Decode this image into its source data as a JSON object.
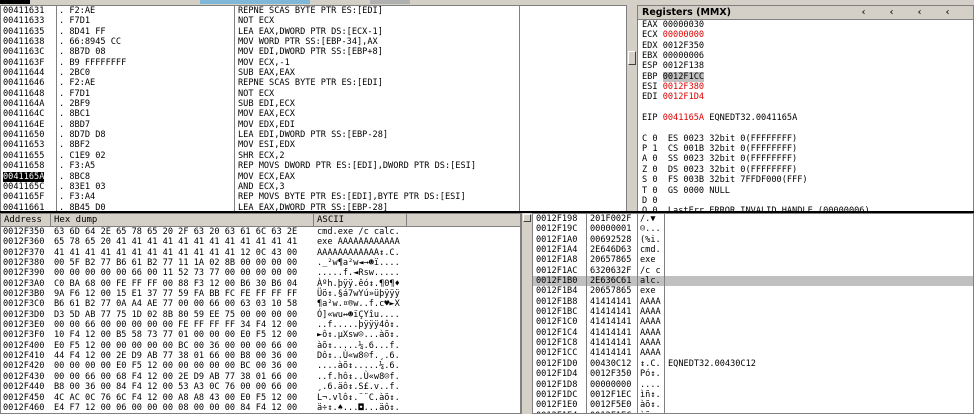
{
  "disasm": {
    "rows": [
      {
        "addr": "00411631",
        "hex": ". F2:AE",
        "asm": "REPNE SCAS BYTE PTR ES:[EDI]",
        "sel": false
      },
      {
        "addr": "00411633",
        "hex": ". F7D1",
        "asm": "NOT ECX",
        "sel": false
      },
      {
        "addr": "00411635",
        "hex": ". 8D41 FF",
        "asm": "LEA EAX,DWORD PTR DS:[ECX-1]",
        "sel": false
      },
      {
        "addr": "00411638",
        "hex": ". 66:8945 CC",
        "asm": "MOV WORD PTR SS:[EBP-34],AX",
        "sel": false
      },
      {
        "addr": "0041163C",
        "hex": ". 8B7D 08",
        "asm": "MOV EDI,DWORD PTR SS:[EBP+8]",
        "sel": false
      },
      {
        "addr": "0041163F",
        "hex": ". B9 FFFFFFFF",
        "asm": "MOV ECX,-1",
        "sel": false
      },
      {
        "addr": "00411644",
        "hex": ". 2BC0",
        "asm": "SUB EAX,EAX",
        "sel": false
      },
      {
        "addr": "00411646",
        "hex": ". F2:AE",
        "asm": "REPNE SCAS BYTE PTR ES:[EDI]",
        "sel": false
      },
      {
        "addr": "00411648",
        "hex": ". F7D1",
        "asm": "NOT ECX",
        "sel": false
      },
      {
        "addr": "0041164A",
        "hex": ". 2BF9",
        "asm": "SUB EDI,ECX",
        "sel": false
      },
      {
        "addr": "0041164C",
        "hex": ". 8BC1",
        "asm": "MOV EAX,ECX",
        "sel": false
      },
      {
        "addr": "0041164E",
        "hex": ". 8BD7",
        "asm": "MOV EDX,EDI",
        "sel": false
      },
      {
        "addr": "00411650",
        "hex": ". 8D7D D8",
        "asm": "LEA EDI,DWORD PTR SS:[EBP-28]",
        "sel": false
      },
      {
        "addr": "00411653",
        "hex": ". 8BF2",
        "asm": "MOV ESI,EDX",
        "sel": false
      },
      {
        "addr": "00411655",
        "hex": ". C1E9 02",
        "asm": "SHR ECX,2",
        "sel": false
      },
      {
        "addr": "00411658",
        "hex": ". F3:A5",
        "asm": "REP MOVS DWORD PTR ES:[EDI],DWORD PTR DS:[ESI]",
        "sel": false
      },
      {
        "addr": "0041165A",
        "hex": ". 8BC8",
        "asm": "MOV ECX,EAX",
        "sel": true
      },
      {
        "addr": "0041165C",
        "hex": ". 83E1 03",
        "asm": "AND ECX,3",
        "sel": false
      },
      {
        "addr": "0041165F",
        "hex": ". F3:A4",
        "asm": "REP MOVS BYTE PTR ES:[EDI],BYTE PTR DS:[ESI]",
        "sel": false
      },
      {
        "addr": "00411661",
        "hex": ". 8B45 D0",
        "asm": "LEA EAX,DWORD PTR SS:[EBP-28]",
        "sel": false
      }
    ]
  },
  "registers": {
    "title": "Registers (MMX)",
    "lines": [
      {
        "text": "EAX 00000030",
        "red": false,
        "grey": false
      },
      {
        "text": "ECX 00000000",
        "red": true,
        "grey": false
      },
      {
        "text": "EDX 0012F350",
        "red": false,
        "grey": false
      },
      {
        "text": "EBX 00000006",
        "red": false,
        "grey": false
      },
      {
        "text": "ESP 0012F138",
        "red": false,
        "grey": false
      },
      {
        "text": "EBP 0012F1CC",
        "red": false,
        "grey": true
      },
      {
        "text": "ESI 0012F380",
        "red": true,
        "grey": false
      },
      {
        "text": "EDI 0012F1D4",
        "red": true,
        "grey": false
      },
      {
        "text": "",
        "red": false,
        "grey": false
      },
      {
        "text": "EIP 0041165A EQNEDT32.0041165A",
        "red": false,
        "grey": false,
        "eip": true
      },
      {
        "text": "",
        "red": false,
        "grey": false
      },
      {
        "text": "C 0  ES 0023 32bit 0(FFFFFFFF)",
        "red": false,
        "grey": false
      },
      {
        "text": "P 1  CS 001B 32bit 0(FFFFFFFF)",
        "red": false,
        "grey": false
      },
      {
        "text": "A 0  SS 0023 32bit 0(FFFFFFFF)",
        "red": false,
        "grey": false
      },
      {
        "text": "Z 0  DS 0023 32bit 0(FFFFFFFF)",
        "red": false,
        "grey": false
      },
      {
        "text": "S 0  FS 003B 32bit 7FFDF000(FFF)",
        "red": false,
        "grey": false
      },
      {
        "text": "T 0  GS 0000 NULL",
        "red": false,
        "grey": false
      },
      {
        "text": "D 0",
        "red": false,
        "grey": false
      },
      {
        "text": "O 0  LastErr ERROR_INVALID_HANDLE (00000006)",
        "red": false,
        "grey": false
      }
    ],
    "eip_addr": "0041165A",
    "eip_rest": " EQNEDT32.0041165A"
  },
  "dump": {
    "col_address": "Address",
    "col_hex": "Hex dump",
    "col_ascii": "ASCII",
    "rows": [
      {
        "addr": "0012F350",
        "hex": "63 6D 64 2E 65 78 65 20 2F 63 20 63 61 6C 63 2E",
        "ascii": "cmd.exe /c calc."
      },
      {
        "addr": "0012F360",
        "hex": "65 78 65 20 41 41 41 41 41 41 41 41 41 41 41 41",
        "ascii": "exe AAAAAAAAAAAA"
      },
      {
        "addr": "0012F370",
        "hex": "41 41 41 41 41 41 41 41 41 41 41 41 12 0C 43 00",
        "ascii": "AAAAAAAAAAAA↕.C."
      },
      {
        "addr": "0012F380",
        "hex": "00 5F B2 77 B6 61 B2 77 11 1A 02 8B 00 00 00 00",
        "ascii": "._²w¶a²w◄→☻ï...."
      },
      {
        "addr": "0012F390",
        "hex": "00 00 00 00 00 66 00 11 52 73 77 00 00 00 00 00",
        "ascii": ".....f.◄Rsw....."
      },
      {
        "addr": "0012F3A0",
        "hex": "C0 BA 68 00 FE FF FF 00 88 F3 12 00 B6 30 B6 04",
        "ascii": "Àºh.þÿÿ.êó↕.¶0¶♦"
      },
      {
        "addr": "0012F3B0",
        "hex": "9A F6 12 00 15 E1 37 77 59 FA BB FC FE FF FF FF",
        "ascii": "Üö↕.§á7wYú»üþÿÿÿ"
      },
      {
        "addr": "0012F3C0",
        "hex": "B6 61 B2 77 0A A4 AE 77 00 00 66 00 63 03 10 58",
        "ascii": "¶a²w.¤®w..f.c♥►X"
      },
      {
        "addr": "0012F3D0",
        "hex": "D3 5D AB 77 75 1D 02 8B 80 59 EE 75 00 00 00 00",
        "ascii": "Ó]«wu↔☻ïÇYîu...."
      },
      {
        "addr": "0012F3E0",
        "hex": "00 00 66 00 00 00 00 00 FE FF FF FF 34 F4 12 00",
        "ascii": "..f.....þÿÿÿ4ô↕."
      },
      {
        "addr": "0012F3F0",
        "hex": "10 F4 12 00 B5 58 73 77 01 00 00 00 E0 F5 12 00",
        "ascii": "►ô↕.µXsw☺...àõ↕."
      },
      {
        "addr": "0012F400",
        "hex": "E0 F5 12 00 00 00 00 00 BC 00 36 00 00 00 66 00",
        "ascii": "àõ↕.....¼.6...f."
      },
      {
        "addr": "0012F410",
        "hex": "44 F4 12 00 2E D9 AB 77 38 01 66 00 B8 00 36 00",
        "ascii": "Dô↕..Ù«w8☺f.¸.6."
      },
      {
        "addr": "0012F420",
        "hex": "00 00 00 00 E0 F5 12 00 00 00 00 00 BC 00 36 00",
        "ascii": "....àõ↕.....¼.6."
      },
      {
        "addr": "0012F430",
        "hex": "00 00 66 00 68 F4 12 00 2E D9 AB 77 38 01 66 00",
        "ascii": "..f.hô↕..Ù«w8☺f."
      },
      {
        "addr": "0012F440",
        "hex": "B8 00 36 00 84 F4 12 00 53 A3 0C 76 00 00 66 00",
        "ascii": "¸.6.äô↕.S£.v..f."
      },
      {
        "addr": "0012F450",
        "hex": "4C AC 0C 76 6C F4 12 00 A8 A8 43 00 E0 F5 12 00",
        "ascii": "L¬.vlô↕.¨¨C.àõ↕."
      },
      {
        "addr": "0012F460",
        "hex": "E4 F7 12 00 06 00 00 00 08 00 00 00 84 F4 12 00",
        "ascii": "ä÷↕.♠...◘...äô↕."
      }
    ]
  },
  "stack": {
    "rows": [
      {
        "addr": "0012F198",
        "val": "201F002F",
        "txt": "/.▼ ",
        "cmt": "",
        "sel": false
      },
      {
        "addr": "0012F19C",
        "val": "00000001",
        "txt": "☺...",
        "cmt": "",
        "sel": false
      },
      {
        "addr": "0012F1A0",
        "val": "00692528",
        "txt": "(%i.",
        "cmt": "",
        "sel": false
      },
      {
        "addr": "0012F1A4",
        "val": "2E646D63",
        "txt": "cmd.",
        "cmt": "",
        "sel": false
      },
      {
        "addr": "0012F1A8",
        "val": "20657865",
        "txt": "exe ",
        "cmt": "",
        "sel": false
      },
      {
        "addr": "0012F1AC",
        "val": "6320632F",
        "txt": "/c c",
        "cmt": "",
        "sel": false
      },
      {
        "addr": "0012F1B0",
        "val": "2E636C61",
        "txt": "alc.",
        "cmt": "",
        "sel": true
      },
      {
        "addr": "0012F1B4",
        "val": "20657865",
        "txt": "exe ",
        "cmt": "",
        "sel": false
      },
      {
        "addr": "0012F1B8",
        "val": "41414141",
        "txt": "AAAA",
        "cmt": "",
        "sel": false
      },
      {
        "addr": "0012F1BC",
        "val": "41414141",
        "txt": "AAAA",
        "cmt": "",
        "sel": false
      },
      {
        "addr": "0012F1C0",
        "val": "41414141",
        "txt": "AAAA",
        "cmt": "",
        "sel": false
      },
      {
        "addr": "0012F1C4",
        "val": "41414141",
        "txt": "AAAA",
        "cmt": "",
        "sel": false
      },
      {
        "addr": "0012F1C8",
        "val": "41414141",
        "txt": "AAAA",
        "cmt": "",
        "sel": false
      },
      {
        "addr": "0012F1CC",
        "val": "41414141",
        "txt": "AAAA",
        "cmt": "",
        "sel": false
      },
      {
        "addr": "0012F1D0",
        "val": "00430C12",
        "txt": "↕.C.",
        "cmt": "EQNEDT32.00430C12",
        "sel": false
      },
      {
        "addr": "0012F1D4",
        "val": "0012F350",
        "txt": "Pó↕.",
        "cmt": "",
        "sel": false
      },
      {
        "addr": "0012F1D8",
        "val": "00000000",
        "txt": "....",
        "cmt": "",
        "sel": false
      },
      {
        "addr": "0012F1DC",
        "val": "0012F1EC",
        "txt": "ìñ↕.",
        "cmt": "",
        "sel": false
      },
      {
        "addr": "0012F1E0",
        "val": "0012F5E0",
        "txt": "àõ↕.",
        "cmt": "",
        "sel": false
      },
      {
        "addr": "0012F1E4",
        "val": "0012F1EC",
        "txt": "ìñ↕.",
        "cmt": "",
        "sel": false
      }
    ]
  },
  "colors": {
    "accent_red": "#e00000",
    "selection": "#000000",
    "highlight_grey": "#c0c0c0",
    "chrome": "#d4d0c8"
  },
  "icons": [
    "scroll-left-icon",
    "scroll-left-icon-2",
    "scroll-left-icon-3",
    "scroll-left-icon-4"
  ]
}
